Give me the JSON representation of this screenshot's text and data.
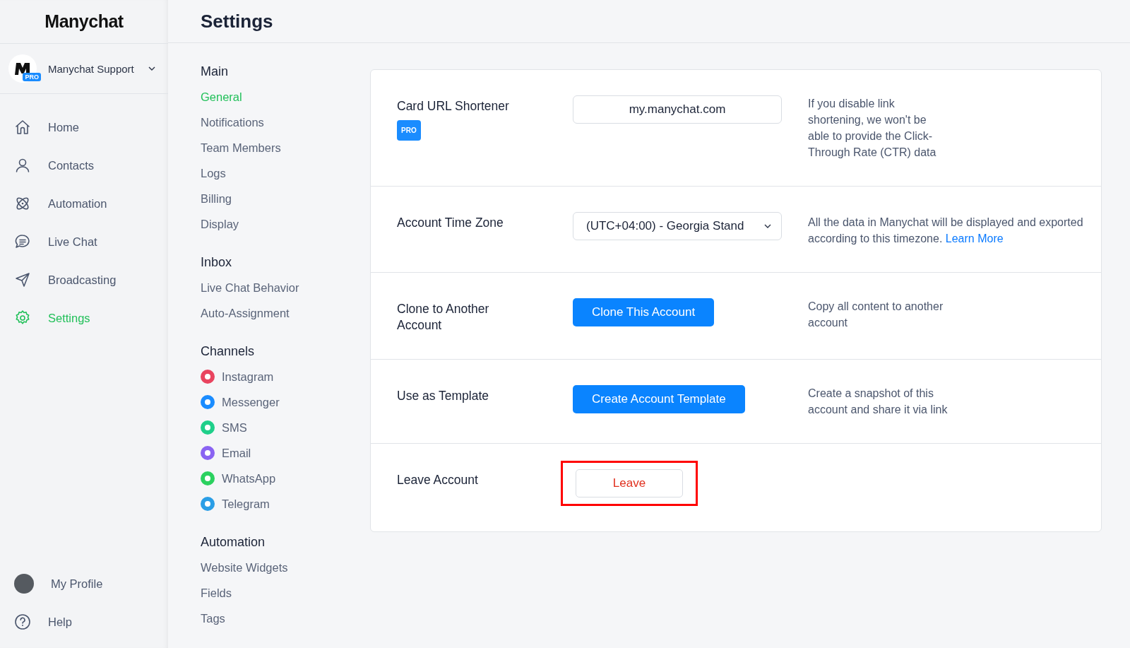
{
  "app": {
    "logo": "Manychat",
    "account": {
      "name": "Manychat Support",
      "badge": "PRO"
    }
  },
  "sidebar": {
    "items": [
      {
        "label": "Home",
        "selected": false
      },
      {
        "label": "Contacts",
        "selected": false
      },
      {
        "label": "Automation",
        "selected": false
      },
      {
        "label": "Live Chat",
        "selected": false
      },
      {
        "label": "Broadcasting",
        "selected": false
      },
      {
        "label": "Settings",
        "selected": true
      }
    ],
    "bottom_items": [
      {
        "label": "My Profile"
      },
      {
        "label": "Help"
      }
    ]
  },
  "page": {
    "title": "Settings"
  },
  "settings_nav": [
    {
      "title": "Main",
      "items": [
        {
          "label": "General",
          "selected": true
        },
        {
          "label": "Notifications",
          "selected": false
        },
        {
          "label": "Team Members",
          "selected": false
        },
        {
          "label": "Logs",
          "selected": false
        },
        {
          "label": "Billing",
          "selected": false
        },
        {
          "label": "Display",
          "selected": false
        }
      ]
    },
    {
      "title": "Inbox",
      "items": [
        {
          "label": "Live Chat Behavior",
          "selected": false
        },
        {
          "label": "Auto-Assignment",
          "selected": false
        }
      ]
    },
    {
      "title": "Channels",
      "items": [
        {
          "label": "Instagram",
          "selected": false,
          "color": "#e9445f"
        },
        {
          "label": "Messenger",
          "selected": false,
          "color": "#1a8cff"
        },
        {
          "label": "SMS",
          "selected": false,
          "color": "#1fcf8a"
        },
        {
          "label": "Email",
          "selected": false,
          "color": "#8a63f2"
        },
        {
          "label": "WhatsApp",
          "selected": false,
          "color": "#2bd15f"
        },
        {
          "label": "Telegram",
          "selected": false,
          "color": "#2a9ee6"
        }
      ]
    },
    {
      "title": "Automation",
      "items": [
        {
          "label": "Website Widgets",
          "selected": false
        },
        {
          "label": "Fields",
          "selected": false
        },
        {
          "label": "Tags",
          "selected": false
        }
      ]
    }
  ],
  "settings_rows": [
    {
      "kind": "input",
      "label": "Card URL Shortener",
      "badge": "PRO",
      "value": "my.manychat.com",
      "description": "If you disable link shortening, we won't be able to provide the Click-Through Rate (CTR) data",
      "highlighted": false
    },
    {
      "kind": "select",
      "label": "Account Time Zone",
      "value": "(UTC+04:00) - Georgia Stand",
      "description": "All the data in Manychat will be displayed and exported according to this timezone.",
      "link": "Learn More",
      "highlighted": false
    },
    {
      "kind": "button",
      "label": "Clone to Another Account",
      "button": "Clone This Account",
      "description": "Copy all content to another account",
      "highlighted": false
    },
    {
      "kind": "button",
      "label": "Use as Template",
      "button": "Create Account Template",
      "description": "Create a snapshot of this account and share it via link",
      "highlighted": false
    },
    {
      "kind": "danger",
      "label": "Leave Account",
      "button": "Leave",
      "highlighted": true
    }
  ]
}
